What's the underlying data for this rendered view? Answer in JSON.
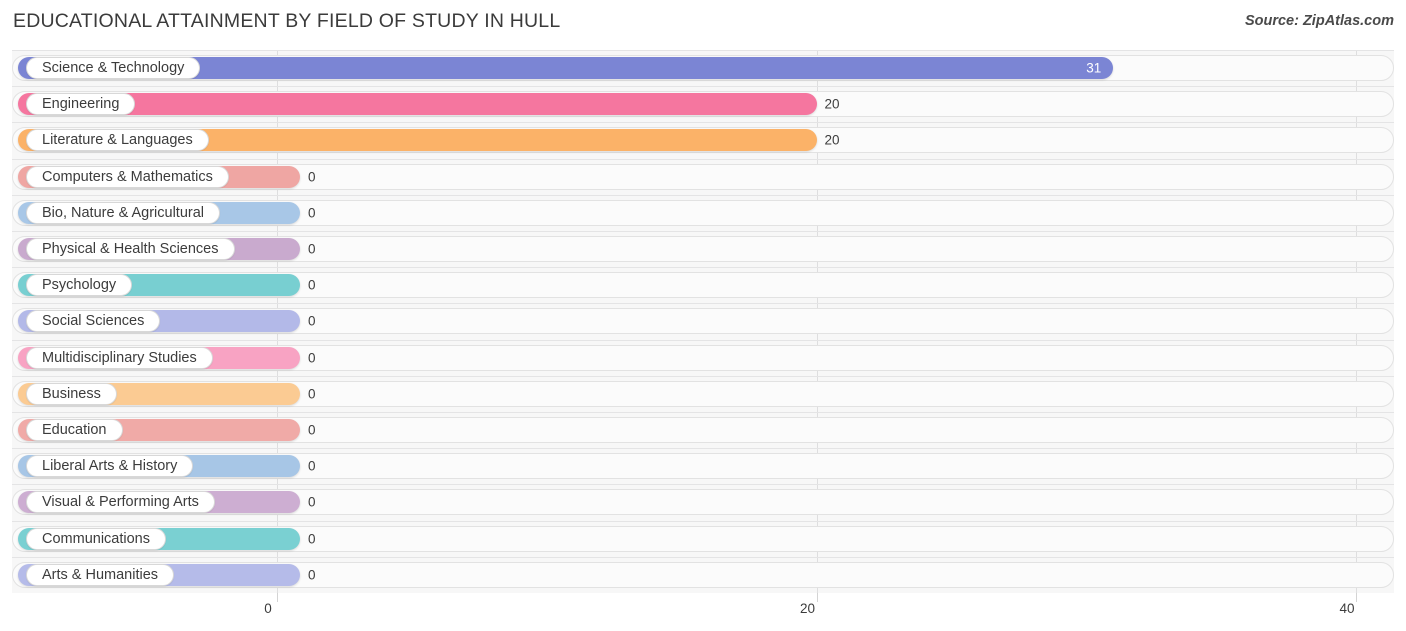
{
  "header": {
    "title": "EDUCATIONAL ATTAINMENT BY FIELD OF STUDY IN HULL",
    "source": "Source: ZipAtlas.com"
  },
  "chart_data": {
    "type": "bar",
    "orientation": "horizontal",
    "title": "EDUCATIONAL ATTAINMENT BY FIELD OF STUDY IN HULL",
    "xlabel": "",
    "ylabel": "",
    "xlim": [
      0,
      40
    ],
    "xticks": [
      "0",
      "20",
      "40"
    ],
    "xtick_values": [
      0,
      20,
      40
    ],
    "grid": true,
    "legend": false,
    "categories": [
      "Science & Technology",
      "Engineering",
      "Literature & Languages",
      "Computers & Mathematics",
      "Bio, Nature & Agricultural",
      "Physical & Health Sciences",
      "Psychology",
      "Social Sciences",
      "Multidisciplinary Studies",
      "Business",
      "Education",
      "Liberal Arts & History",
      "Visual & Performing Arts",
      "Communications",
      "Arts & Humanities"
    ],
    "values": [
      31,
      20,
      20,
      0,
      0,
      0,
      0,
      0,
      0,
      0,
      0,
      0,
      0,
      0,
      0
    ],
    "value_labels": [
      "31",
      "20",
      "20",
      "0",
      "0",
      "0",
      "0",
      "0",
      "0",
      "0",
      "0",
      "0",
      "0",
      "0",
      "0"
    ],
    "colors": [
      "#7b85d4",
      "#f5769f",
      "#fbb268",
      "#efa6a3",
      "#a8c7e7",
      "#c9aace",
      "#78cfd1",
      "#b3b9e8",
      "#f8a3c3",
      "#fbcb93",
      "#f0aaa7",
      "#a7c6e6",
      "#cdaed2",
      "#7ad0d2",
      "#b5bbe9"
    ]
  }
}
